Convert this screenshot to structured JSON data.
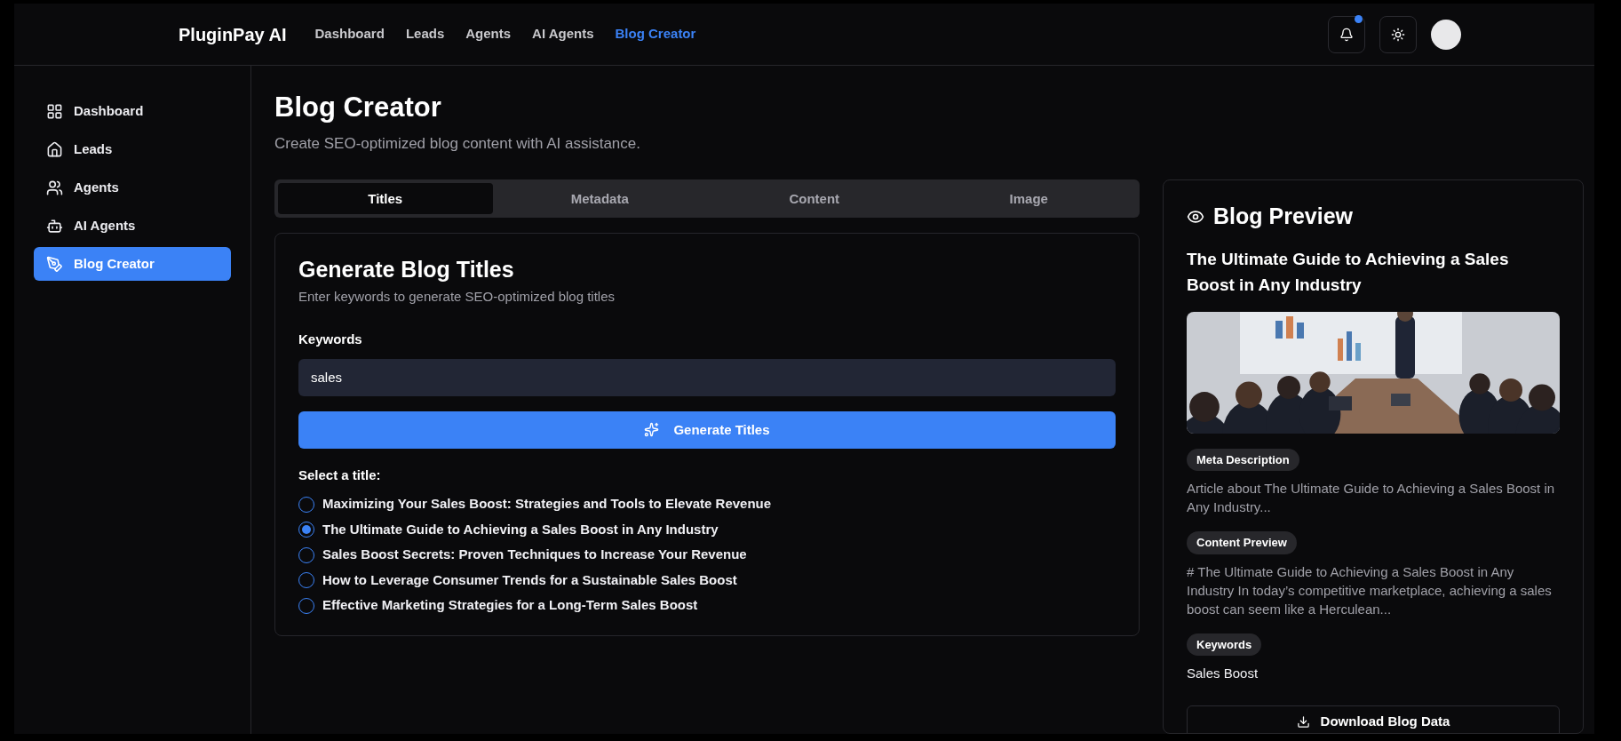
{
  "top_nav": {
    "brand": "PluginPay AI",
    "links": [
      {
        "label": "Dashboard",
        "selected": false
      },
      {
        "label": "Leads",
        "selected": false
      },
      {
        "label": "Agents",
        "selected": false
      },
      {
        "label": "AI Agents",
        "selected": false
      },
      {
        "label": "Blog Creator",
        "selected": true
      }
    ],
    "notification_unread": true
  },
  "sidebar": {
    "items": [
      {
        "label": "Dashboard",
        "kind": "grid",
        "selected": false
      },
      {
        "label": "Leads",
        "kind": "home",
        "selected": false
      },
      {
        "label": "Agents",
        "kind": "users",
        "selected": false
      },
      {
        "label": "AI Agents",
        "kind": "bot",
        "selected": false
      },
      {
        "label": "Blog Creator",
        "kind": "pen",
        "selected": true
      }
    ]
  },
  "page": {
    "title": "Blog Creator",
    "subtitle": "Create SEO-optimized blog content with AI assistance."
  },
  "tabs": [
    {
      "label": "Titles",
      "selected": true
    },
    {
      "label": "Metadata",
      "selected": false
    },
    {
      "label": "Content",
      "selected": false
    },
    {
      "label": "Image",
      "selected": false
    }
  ],
  "titles_card": {
    "heading": "Generate Blog Titles",
    "subheading": "Enter keywords to generate SEO-optimized blog titles",
    "keywords_label": "Keywords",
    "keywords_value": "sales",
    "generate_button": "Generate Titles",
    "select_label": "Select a title:",
    "options": [
      {
        "label": "Maximizing Your Sales Boost: Strategies and Tools to Elevate Revenue",
        "selected": false
      },
      {
        "label": "The Ultimate Guide to Achieving a Sales Boost in Any Industry",
        "selected": true
      },
      {
        "label": "Sales Boost Secrets: Proven Techniques to Increase Your Revenue",
        "selected": false
      },
      {
        "label": "How to Leverage Consumer Trends for a Sustainable Sales Boost",
        "selected": false
      },
      {
        "label": "Effective Marketing Strategies for a Long-Term Sales Boost",
        "selected": false
      }
    ]
  },
  "preview": {
    "heading": "Blog Preview",
    "title": "The Ultimate Guide to Achieving a Sales Boost in Any Industry",
    "sections": [
      {
        "label": "Meta Description",
        "text": "Article about The Ultimate Guide to Achieving a Sales Boost in Any Industry...",
        "emphasis": false
      },
      {
        "label": "Content Preview",
        "text": "# The Ultimate Guide to Achieving a Sales Boost in Any Industry In today’s competitive marketplace, achieving a sales boost can seem like a Herculean...",
        "emphasis": false
      },
      {
        "label": "Keywords",
        "text": "Sales Boost",
        "emphasis": true
      }
    ],
    "download_button": "Download Blog Data"
  }
}
